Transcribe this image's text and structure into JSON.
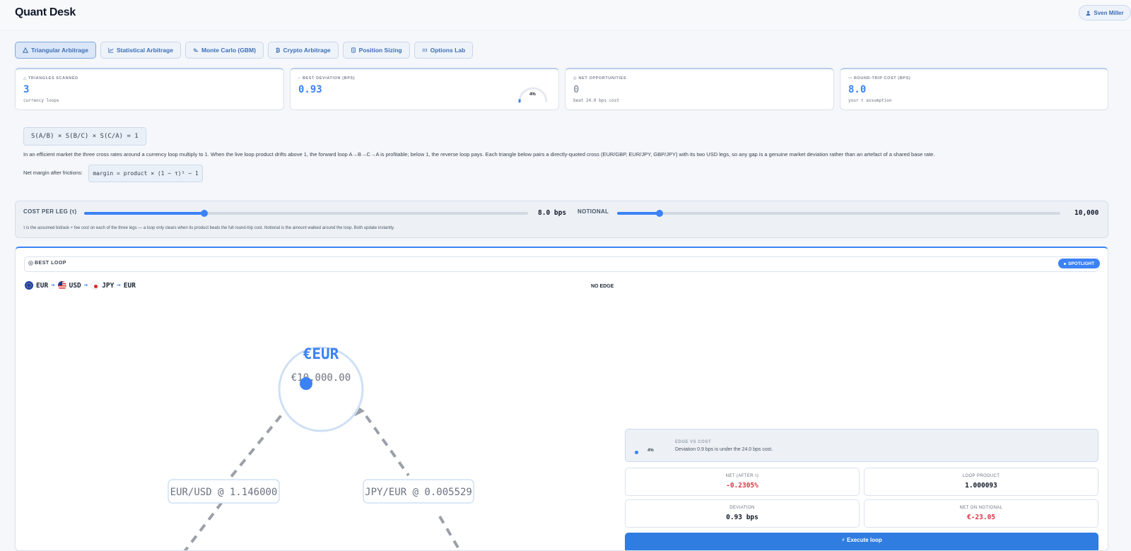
{
  "app": {
    "title": "Quant Desk",
    "user": "Sven Miller"
  },
  "tabs": [
    {
      "label": "Triangular Arbitrage",
      "icon": "triangle-icon",
      "active": true
    },
    {
      "label": "Statistical Arbitrage",
      "icon": "line-chart-icon"
    },
    {
      "label": "Monte Carlo (GBM)",
      "icon": "random-walk-icon"
    },
    {
      "label": "Crypto Arbitrage",
      "icon": "bitcoin-icon"
    },
    {
      "label": "Position Sizing",
      "icon": "calculator-icon"
    },
    {
      "label": "Options Lab",
      "icon": "grid-icon"
    }
  ],
  "stats": {
    "triangles": {
      "label": "TRIANGLES SCANNED",
      "value": "3",
      "sub": "currency loops"
    },
    "deviation": {
      "label": "BEST DEVIATION (BPS)",
      "value": "0.93",
      "gauge_label": "4%",
      "gauge_fraction": 0.04
    },
    "opportunities": {
      "label": "NET OPPORTUNITIES",
      "value": "0",
      "sub": "beat 24.0 bps cost"
    },
    "cost": {
      "label": "ROUND-TRIP COST (BPS)",
      "value": "8.0",
      "sub": "your τ assumption"
    }
  },
  "theory": {
    "formula": "S(A/B) × S(B/C) × S(C/A) = 1",
    "explanation": "In an efficient market the three cross rates around a currency loop multiply to 1. When the live loop product drifts above 1, the forward loop A→B→C→A is profitable; below 1, the reverse loop pays. Each triangle below pairs a directly-quoted cross (EUR/GBP, EUR/JPY, GBP/JPY) with its two USD legs, so any gap is a genuine market deviation rather than an artefact of a shared base rate.",
    "net_label": "Net margin after frictions:",
    "margin_formula": "margin = product × (1 − τ)³ − 1"
  },
  "controls": {
    "cost": {
      "label": "COST PER LEG (τ)",
      "value": "8.0 bps",
      "fraction": 0.27
    },
    "notional": {
      "label": "NOTIONAL",
      "value": "10,000",
      "fraction": 0.096
    },
    "note": "τ is the assumed bid/ask + fee cost on each of the three legs — a loop only clears when its product beats the full round-trip cost. Notional is the amount walked around the loop. Both update instantly."
  },
  "best_loop": {
    "label": "BEST LOOP",
    "spotlight": "SPOTLIGHT",
    "route": [
      "EUR",
      "USD",
      "JPY",
      "EUR"
    ],
    "status": "NO EDGE",
    "node": {
      "currency": "€EUR",
      "amount": "€10,000.00"
    },
    "legs": {
      "left": "EUR/USD @ 1.146000",
      "right": "JPY/EUR @ 0.005529"
    },
    "edge": {
      "title": "EDGE VS COST",
      "text": "Deviation 0.9 bps is under the 24.0 bps cost.",
      "pct": "4%",
      "fraction": 0.04
    },
    "metrics": [
      {
        "label": "NET (AFTER τ)",
        "value": "-0.2305%",
        "negative": true
      },
      {
        "label": "LOOP PRODUCT",
        "value": "1.000093"
      },
      {
        "label": "DEVIATION",
        "value": "0.93 bps"
      },
      {
        "label": "NET ON NOTIONAL",
        "value": "€-23.05",
        "negative": true
      }
    ],
    "execute_label": "⚡ Execute loop"
  },
  "colors": {
    "accent": "#3b82f6",
    "negative": "#dc3545",
    "muted": "#9aa3ad"
  }
}
